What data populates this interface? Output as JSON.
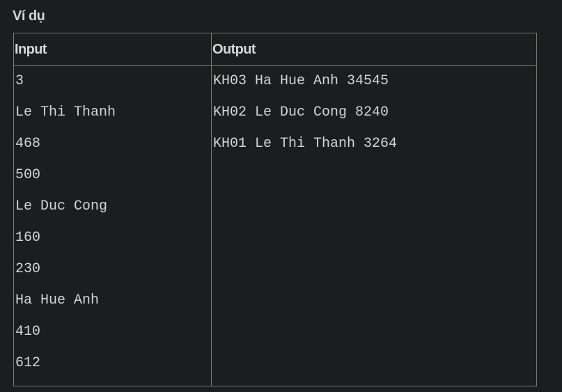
{
  "section": {
    "heading": "Ví dụ"
  },
  "example_table": {
    "headers": {
      "input": "Input",
      "output": "Output"
    },
    "input_lines": [
      "3",
      "Le Thi Thanh",
      "468",
      "500",
      "Le Duc Cong",
      "160",
      "230",
      "Ha Hue Anh",
      "410",
      "612"
    ],
    "output_lines": [
      "KH03 Ha Hue Anh 34545",
      "KH02 Le Duc Cong 8240",
      "KH01 Le Thi Thanh 3264"
    ]
  }
}
